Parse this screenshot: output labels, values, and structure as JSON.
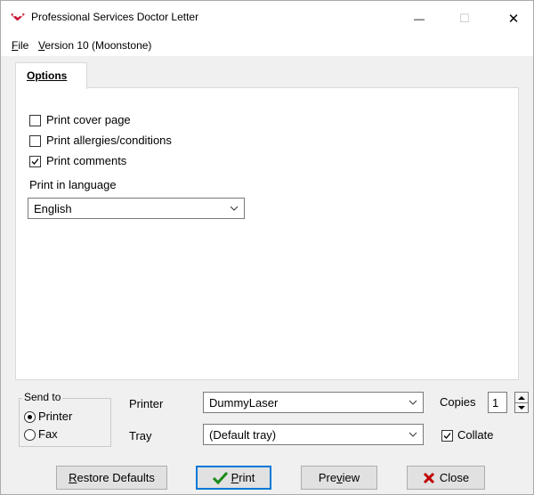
{
  "window": {
    "title": "Professional Services Doctor Letter",
    "minimize_glyph": "—",
    "maximize_glyph": "☐",
    "close_glyph": "✕"
  },
  "menu": {
    "file_first": "F",
    "file_rest": "ile",
    "version_first": "V",
    "version_rest": "ersion 10 (Moonstone)"
  },
  "tabs": [
    {
      "label": "Options"
    }
  ],
  "options": {
    "print_cover_page": {
      "label": "Print cover page",
      "checked": false
    },
    "print_allergies": {
      "label": "Print allergies/conditions",
      "checked": false
    },
    "print_comments": {
      "label": "Print comments",
      "checked": true
    },
    "language_label": "Print in language",
    "language_value": "English"
  },
  "send_to": {
    "title": "Send to",
    "printer_label": "Printer",
    "fax_label": "Fax",
    "selected": "Printer"
  },
  "printer": {
    "printer_label": "Printer",
    "printer_value": "DummyLaser",
    "tray_label": "Tray",
    "tray_value": "(Default tray)",
    "copies_label": "Copies",
    "copies_value": "1",
    "collate_label": "Collate",
    "collate_checked": true
  },
  "buttons": {
    "restore_first": "R",
    "restore_rest": "estore Defaults",
    "print_first": "P",
    "print_rest": "rint",
    "preview_pre": "Pre",
    "preview_u": "v",
    "preview_post": "iew",
    "close_label": "Close"
  },
  "colors": {
    "accent": "#0078d7",
    "check_green": "#1a8a1a",
    "close_red": "#c00000",
    "app_icon_red": "#c8102e"
  },
  "icons": {
    "app": "stethoscope-icon",
    "print": "check-icon",
    "close": "x-icon"
  }
}
